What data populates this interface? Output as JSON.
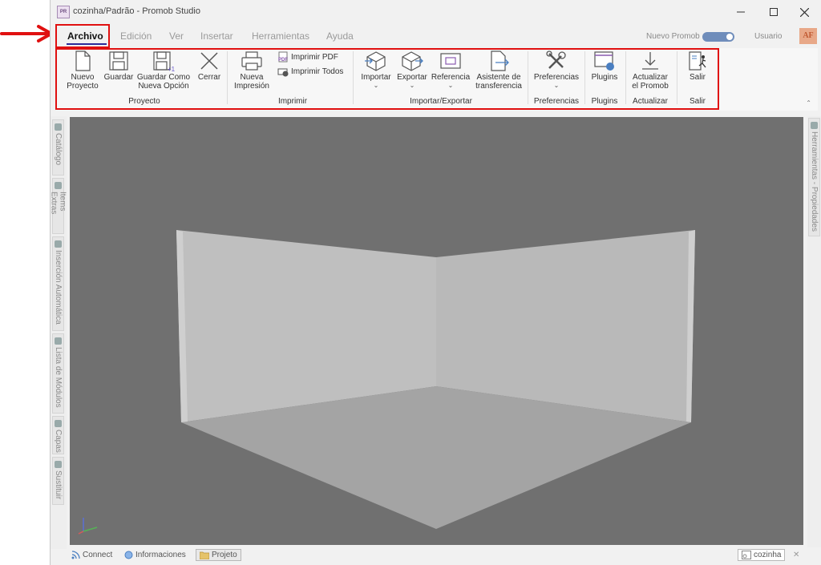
{
  "window": {
    "title": "cozinha/Padrão - Promob Studio",
    "app_icon_text": "PR"
  },
  "menu": {
    "tabs": [
      "Archivo",
      "Edición",
      "Ver",
      "Insertar",
      "Herramientas",
      "Ayuda"
    ],
    "active": "Archivo",
    "nuevo_promob_label": "Nuevo Promob",
    "nuevo_promob_on": true,
    "user_label": "Usuario",
    "avatar_initials": "AF"
  },
  "ribbon": {
    "proyecto": {
      "group_label": "Proyecto",
      "nuevo_l1": "Nuevo",
      "nuevo_l2": "Proyecto",
      "guardar": "Guardar",
      "guardar_como_l1": "Guardar Como",
      "guardar_como_l2": "Nueva Opción",
      "cerrar": "Cerrar"
    },
    "imprimir": {
      "group_label": "Imprimir",
      "nueva_l1": "Nueva",
      "nueva_l2": "Impresión",
      "pdf": "Imprimir PDF",
      "todos": "Imprimir Todos"
    },
    "importar_exportar": {
      "group_label": "Importar/Exportar",
      "importar": "Importar",
      "exportar": "Exportar",
      "referencia": "Referencia",
      "asistente_l1": "Asistente de",
      "asistente_l2": "transferencia"
    },
    "preferencias": {
      "group_label": "Preferencias",
      "button": "Preferencias"
    },
    "plugins": {
      "group_label": "Plugins",
      "button": "Plugins"
    },
    "actualizar": {
      "group_label": "Actualizar",
      "l1": "Actualizar",
      "l2": "el Promob"
    },
    "salir": {
      "group_label": "Salir",
      "button": "Salir"
    }
  },
  "left_panel": {
    "tabs": [
      "Catálogo",
      "Items Extras",
      "Inserción Automática",
      "Lista de Módulos",
      "Capas",
      "Sustituir"
    ]
  },
  "right_panel": {
    "tab": "Herramientas - Propiedades"
  },
  "statusbar": {
    "connect": "Connect",
    "informaciones": "Informaciones",
    "projeto": "Projeto",
    "document": "cozinha"
  },
  "colors": {
    "highlight": "#e01010",
    "active_tab_underline": "#2b2b9a",
    "viewport_bg": "#707070",
    "wall": "#bfbfbf"
  }
}
